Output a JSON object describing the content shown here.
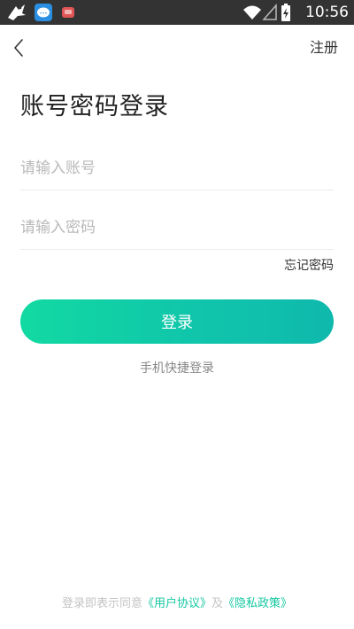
{
  "status_bar": {
    "time": "10:56",
    "icons": [
      "bird-app-icon",
      "chat-app-icon",
      "red-app-icon",
      "wifi-icon",
      "signal-icon",
      "battery-charging-icon"
    ]
  },
  "nav": {
    "back_icon": "chevron-left-icon",
    "register_label": "注册"
  },
  "title": "账号密码登录",
  "form": {
    "account_placeholder": "请输入账号",
    "account_value": "",
    "password_placeholder": "请输入密码",
    "password_value": "",
    "forgot_label": "忘记密码",
    "login_label": "登录"
  },
  "quick_login_label": "手机快捷登录",
  "agreement": {
    "prefix": "登录即表示同意",
    "user_agreement": "《用户协议》",
    "conjunction": "及",
    "privacy_policy": "《隐私政策》"
  },
  "colors": {
    "accent": "#14c7a0",
    "button_start": "#12d9a2",
    "button_end": "#0fb9ad",
    "status_bar": "#333333"
  }
}
